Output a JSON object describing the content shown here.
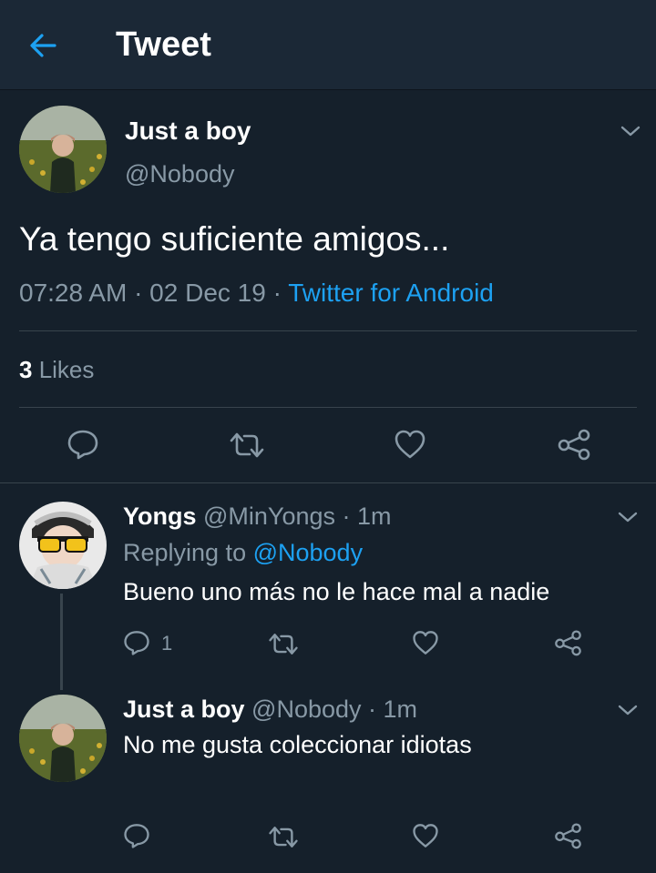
{
  "header": {
    "title": "Tweet"
  },
  "main_tweet": {
    "name": "Just a boy",
    "handle": "@Nobody",
    "text": "Ya tengo suficiente amigos...",
    "time": "07:28 AM · 02 Dec 19 · ",
    "source": "Twitter for Android",
    "likes_count": "3",
    "likes_label": " Likes"
  },
  "replies": [
    {
      "name": "Yongs",
      "handle": " @MinYongs · 1m",
      "replying_to_label": "Replying to ",
      "replying_to_handle": "@Nobody",
      "text": "Bueno uno más no le hace mal a nadie",
      "reply_count": "1"
    },
    {
      "name": "Just a boy",
      "handle": " @Nobody · 1m",
      "text": "No me gusta coleccionar idiotas"
    }
  ],
  "colors": {
    "background": "#15202b",
    "accent": "#1da1f2",
    "muted": "#8899a6"
  },
  "icons": [
    "back-arrow-icon",
    "chevron-down-icon",
    "reply-icon",
    "retweet-icon",
    "like-icon",
    "share-icon"
  ]
}
